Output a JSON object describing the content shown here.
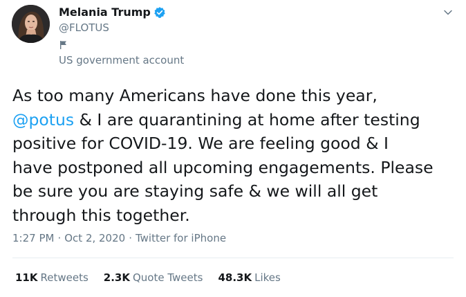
{
  "author": {
    "display_name": "Melania Trump",
    "handle": "@FLOTUS",
    "verified": true,
    "account_label": "US government account",
    "avatar_icon": "profile-photo",
    "label_icon": "flag-icon"
  },
  "tweet": {
    "lines": [
      [
        "As too many Americans have done this year,"
      ],
      [
        "@potus",
        " & I are quarantining at home after testing"
      ],
      [
        "positive for COVID-19. We are feeling good & I"
      ],
      [
        "have postponed all upcoming engagements. Please"
      ],
      [
        "be sure you are staying safe & we will all get"
      ],
      [
        "through this together."
      ]
    ],
    "mention": "@potus",
    "time": "1:27 PM",
    "separator": "·",
    "date": "Oct 2, 2020",
    "source": "Twitter for iPhone"
  },
  "stats": [
    {
      "count": "11K",
      "label": "Retweets"
    },
    {
      "count": "2.3K",
      "label": "Quote Tweets"
    },
    {
      "count": "48.3K",
      "label": "Likes"
    }
  ],
  "colors": {
    "text": "#14171a",
    "secondary": "#657786",
    "link": "#1da1f2",
    "divider": "#e6ecf0"
  }
}
